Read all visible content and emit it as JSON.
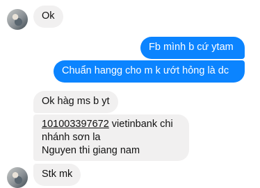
{
  "messages": [
    {
      "text": "Ok"
    },
    {
      "text": "Fb mình b cứ ytam"
    },
    {
      "text": "Chuẩn hangg cho m k ướt hỏng là dc"
    },
    {
      "text": "Ok hàg ms b yt"
    },
    {
      "account_number": "101003397672",
      "line1_rest": " vietinbank chi",
      "line2": "nhánh sơn la",
      "line3": "Nguyen thi giang nam"
    },
    {
      "text": "Stk mk"
    }
  ]
}
